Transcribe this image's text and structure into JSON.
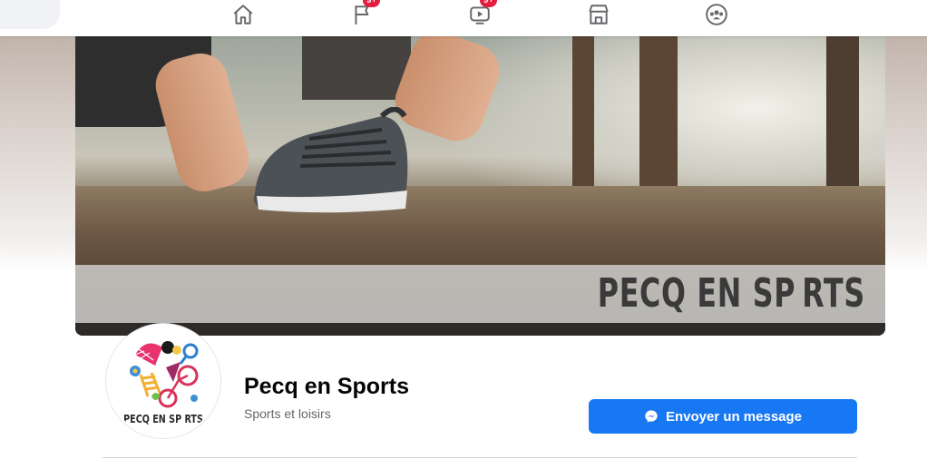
{
  "topbar": {
    "nav": [
      {
        "icon": "home-icon",
        "badge": ""
      },
      {
        "icon": "flag-icon",
        "badge": "9+"
      },
      {
        "icon": "video-icon",
        "badge": "9+"
      },
      {
        "icon": "marketplace-icon",
        "badge": ""
      },
      {
        "icon": "groups-icon",
        "badge": ""
      }
    ]
  },
  "cover": {
    "title": "PECQ EN SP RTS"
  },
  "profile": {
    "avatar_text": "PECQ EN SP RTS",
    "name": "Pecq en Sports",
    "category": "Sports et loisirs",
    "message_button": "Envoyer un message"
  },
  "colors": {
    "accent": "#1877f2",
    "badge": "#e41e3f"
  }
}
